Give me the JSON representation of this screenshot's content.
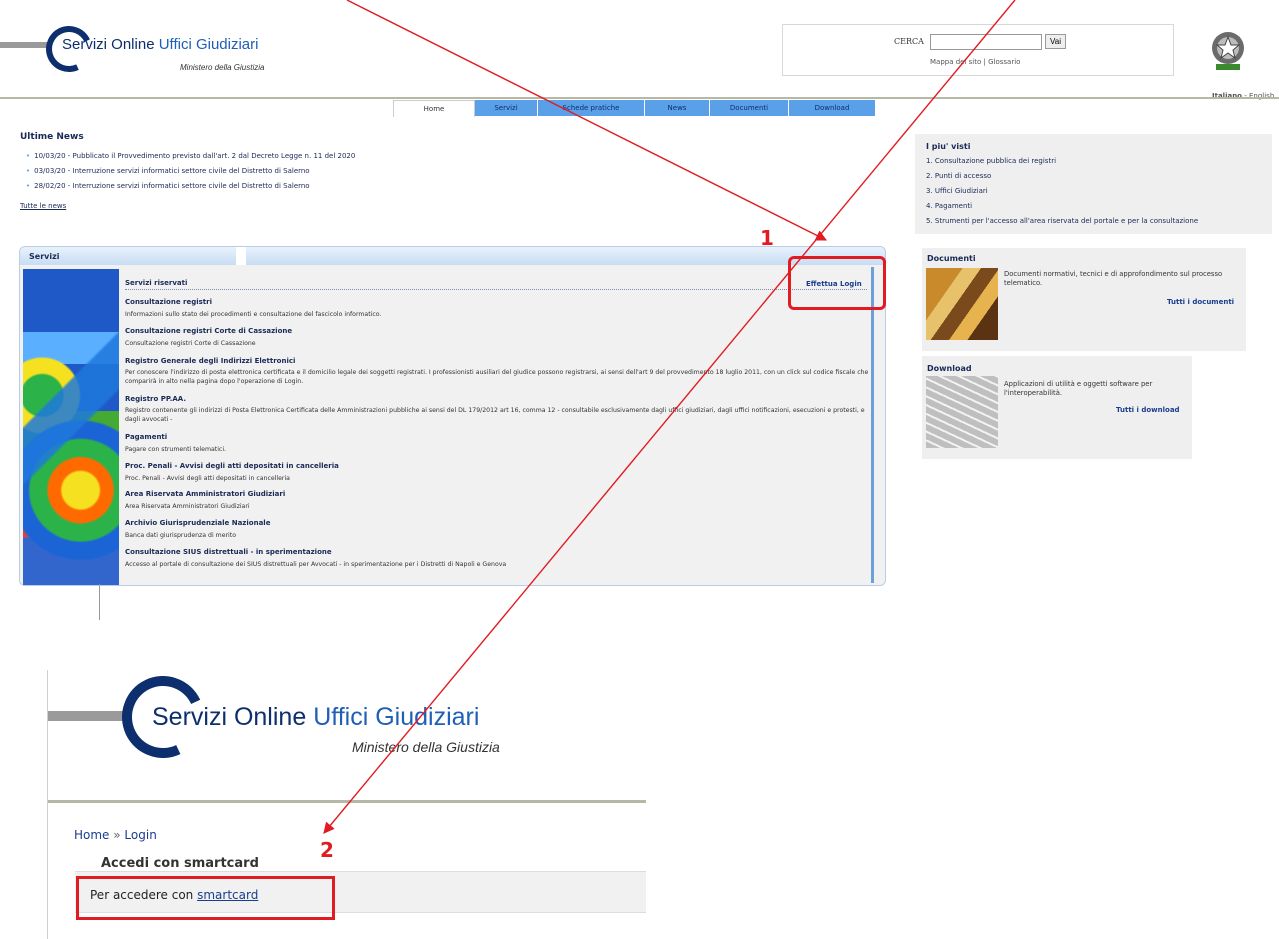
{
  "header": {
    "title_part1": "Servizi Online",
    "title_part2": "Uffici Giudiziari",
    "subtitle": "Ministero della Giustizia",
    "logo_letter": "S"
  },
  "search": {
    "label": "CERCA",
    "value": "",
    "button": "Vai",
    "links": "Mappa del sito | Glossario"
  },
  "language": {
    "current": "Italiano",
    "separator": " - ",
    "other": "English"
  },
  "nav": {
    "tabs": [
      {
        "label": "Home",
        "active": true
      },
      {
        "label": "Servizi"
      },
      {
        "label": "Schede pratiche"
      },
      {
        "label": "News"
      },
      {
        "label": "Documenti"
      },
      {
        "label": "Download"
      }
    ]
  },
  "news": {
    "title": "Ultime News",
    "items": [
      "10/03/20 - Pubblicato il Provvedimento previsto dall'art. 2 dal Decreto Legge n. 11 del 2020",
      "03/03/20 - Interruzione servizi informatici settore civile del Distretto di Salerno",
      "28/02/20 - Interruzione servizi informatici settore civile del Distretto di Salerno"
    ],
    "all_link": "Tutte le news"
  },
  "services": {
    "panel_title": "Servizi",
    "reserved_title": "Servizi riservati",
    "login_link": "Effettua Login",
    "items": [
      {
        "title": "Consultazione registri",
        "desc": "Informazioni sullo stato dei procedimenti e consultazione del fascicolo informatico."
      },
      {
        "title": "Consultazione registri Corte di Cassazione",
        "desc": "Consultazione registri Corte di Cassazione"
      },
      {
        "title": "Registro Generale degli Indirizzi Elettronici",
        "desc": "Per conoscere l'indirizzo di posta elettronica certificata e il domicilio legale dei soggetti registrati. I professionisti ausiliari del giudice possono registrarsi, ai sensi dell'art 9 del provvedimento 18 luglio 2011, con un click sul codice fiscale che comparirà in alto nella pagina dopo l'operazione di Login."
      },
      {
        "title": "Registro PP.AA.",
        "desc": "Registro contenente gli indirizzi di Posta Elettronica Certificata delle Amministrazioni pubbliche ai sensi del DL 179/2012 art 16, comma 12 - consultabile esclusivamente dagli uffici giudiziari, dagli uffici notificazioni, esecuzioni e protesti, e dagli avvocati -"
      },
      {
        "title": "Pagamenti",
        "desc": "Pagare con strumenti telematici."
      },
      {
        "title": "Proc. Penali - Avvisi degli atti depositati in cancelleria",
        "desc": "Proc. Penali - Avvisi degli atti depositati in cancelleria"
      },
      {
        "title": "Area Riservata Amministratori Giudiziari",
        "desc": "Area Riservata Amministratori Giudiziari"
      },
      {
        "title": "Archivio Giurisprudenziale Nazionale",
        "desc": "Banca dati giurisprudenza di merito"
      },
      {
        "title": "Consultazione SIUS distrettuali - in sperimentazione",
        "desc": "Accesso al portale di consultazione dei SIUS distrettuali per Avvocati - in sperimentazione per i Distretti di Napoli e Genova"
      }
    ]
  },
  "most_viewed": {
    "title": "I piu' visti",
    "items": [
      "1. Consultazione pubblica dei registri",
      "2. Punti di accesso",
      "3. Uffici Giudiziari",
      "4. Pagamenti",
      "5. Strumenti per l'accesso all'area riservata del portale e per la consultazione"
    ]
  },
  "documents": {
    "title": "Documenti",
    "desc": "Documenti normativi, tecnici e di approfondimento sul processo telematico.",
    "more": "Tutti i documenti"
  },
  "downloads": {
    "title": "Download",
    "desc": "Applicazioni di utilità e oggetti software per l'interoperabilità.",
    "more": "Tutti i download"
  },
  "login_page": {
    "breadcrumb_home": "Home",
    "breadcrumb_sep": " » ",
    "breadcrumb_current": "Login",
    "section_title": "Accedi con smartcard",
    "text_prefix": "Per accedere con ",
    "smartcard_link": "smartcard"
  },
  "annotations": {
    "step1": "1",
    "step2": "2",
    "color": "#e11b22"
  },
  "colors": {
    "brand_dark": "#0d2f6e",
    "brand_blue": "#1f5fb5",
    "tab_blue": "#5aa0e8"
  }
}
